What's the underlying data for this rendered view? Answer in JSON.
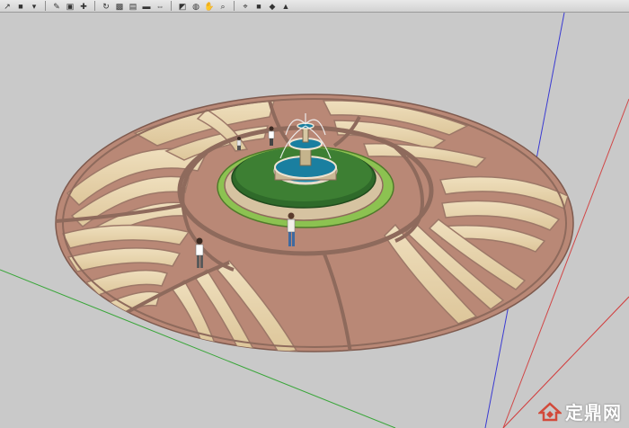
{
  "toolbar": {
    "tools": [
      {
        "icon": "arrow-select-icon",
        "glyph": "↗"
      },
      {
        "icon": "eraser-icon",
        "glyph": "■"
      },
      {
        "icon": "dropdown-icon",
        "glyph": "▾"
      },
      {
        "icon": "pencil-icon",
        "glyph": "✎"
      },
      {
        "icon": "push-pull-icon",
        "glyph": "▣"
      },
      {
        "icon": "move-icon",
        "glyph": "✚"
      },
      {
        "icon": "rotate-icon",
        "glyph": "↻"
      },
      {
        "icon": "follow-me-icon",
        "glyph": "▩"
      },
      {
        "icon": "offset-icon",
        "glyph": "▤"
      },
      {
        "icon": "tape-measure-icon",
        "glyph": "▬"
      },
      {
        "icon": "dimension-icon",
        "glyph": "⇔"
      },
      {
        "icon": "paint-bucket-icon",
        "glyph": "◩"
      },
      {
        "icon": "orbit-icon",
        "glyph": "◍"
      },
      {
        "icon": "pan-icon",
        "glyph": "✋"
      },
      {
        "icon": "zoom-icon",
        "glyph": "⌕"
      },
      {
        "icon": "zoom-extents-icon",
        "glyph": "⌖"
      },
      {
        "icon": "warehouse-icon",
        "glyph": "■"
      },
      {
        "icon": "components-icon",
        "glyph": "◆"
      },
      {
        "icon": "share-icon",
        "glyph": "▲"
      }
    ]
  },
  "colors": {
    "background": "#c9c9c9",
    "terracotta": "#b98876",
    "cream": "#e9d6ae",
    "border_dark": "#8e6a5c",
    "lawn_light": "#8cc251",
    "hedge": "#2f6a2a",
    "water": "#1e8db0",
    "axis_red": "#d23a3a",
    "axis_green": "#3aa63a",
    "axis_blue": "#3a3ad2"
  },
  "watermark": {
    "logo": "house-logo-icon",
    "text": "定鼎网"
  }
}
